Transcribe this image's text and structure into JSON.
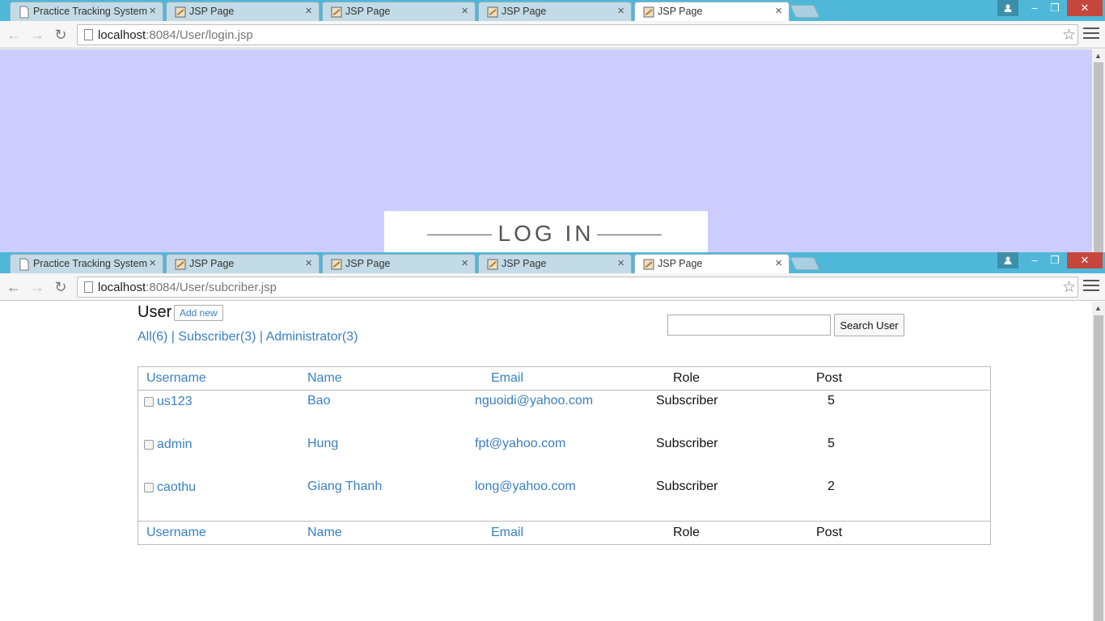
{
  "browser": {
    "tabs": [
      {
        "title": "Practice Tracking System"
      },
      {
        "title": "JSP Page"
      },
      {
        "title": "JSP Page"
      },
      {
        "title": "JSP Page"
      },
      {
        "title": "JSP Page"
      }
    ],
    "tab_close_glyph": "×",
    "window_controls": {
      "minimize": "–",
      "restore": "❐",
      "close": "✕"
    }
  },
  "window1": {
    "url_host": "localhost",
    "url_path": ":8084/User/login.jsp",
    "login_title": "LOG IN",
    "colors": {
      "background": "#ccccff"
    }
  },
  "window2": {
    "url_host": "localhost",
    "url_path": ":8084/User/subcriber.jsp",
    "heading": "User",
    "add_new": "Add new",
    "filters": {
      "all": "All(6)",
      "sep1": " | ",
      "subscriber": "Subscriber(3)",
      "sep2": " | ",
      "administrator": "Administrator(3)"
    },
    "search": {
      "value": "",
      "button": "Search User"
    },
    "columns": [
      "Username",
      "Name",
      "Email",
      "Role",
      "Post"
    ],
    "rows": [
      {
        "username": "us123",
        "name": "Bao",
        "email": "nguoidi@yahoo.com",
        "role": "Subscriber",
        "post": "5"
      },
      {
        "username": "admin",
        "name": "Hung",
        "email": "fpt@yahoo.com",
        "role": "Subscriber",
        "post": "5"
      },
      {
        "username": "caothu",
        "name": "Giang Thanh",
        "email": "long@yahoo.com",
        "role": "Subscriber",
        "post": "2"
      }
    ]
  },
  "colors": {
    "link": "#3a80c0",
    "tabstrip": "#4fb8d8"
  }
}
